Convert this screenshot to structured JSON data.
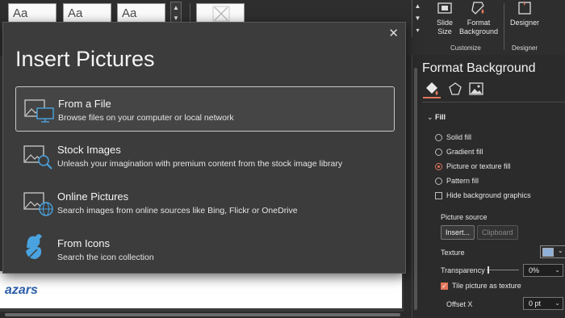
{
  "ribbon": {
    "theme_sample": "Aa",
    "slide_size_label": "Slide Size",
    "format_background_label": "Format Background",
    "customize_group": "Customize",
    "designer_label": "Designer",
    "designer_group": "Designer"
  },
  "dialog": {
    "title": "Insert Pictures",
    "close": "✕",
    "options": [
      {
        "title": "From a File",
        "desc": "Browse files on your computer or local network"
      },
      {
        "title": "Stock Images",
        "desc": "Unleash your imagination with premium content from the stock image library"
      },
      {
        "title": "Online Pictures",
        "desc": "Search images from online sources like Bing, Flickr or OneDrive"
      },
      {
        "title": "From Icons",
        "desc": "Search the icon collection"
      }
    ]
  },
  "slide": {
    "brand_text": "azars"
  },
  "pane": {
    "title": "Format Background",
    "fill_header": "Fill",
    "solid_fill": "Solid fill",
    "gradient_fill": "Gradient fill",
    "picture_fill": "Picture or texture fill",
    "pattern_fill": "Pattern fill",
    "hide_graphics": "Hide background graphics",
    "picture_source": "Picture source",
    "insert_button": "Insert...",
    "clipboard_button": "Clipboard",
    "texture_label": "Texture",
    "transparency_label": "Transparency",
    "transparency_value": "0%",
    "tile_label": "Tile picture as texture",
    "offset_x_label": "Offset X",
    "offset_x_value": "0 pt"
  },
  "colors": {
    "accent": "#e0765a",
    "brand_blue": "#2c5ea8"
  }
}
